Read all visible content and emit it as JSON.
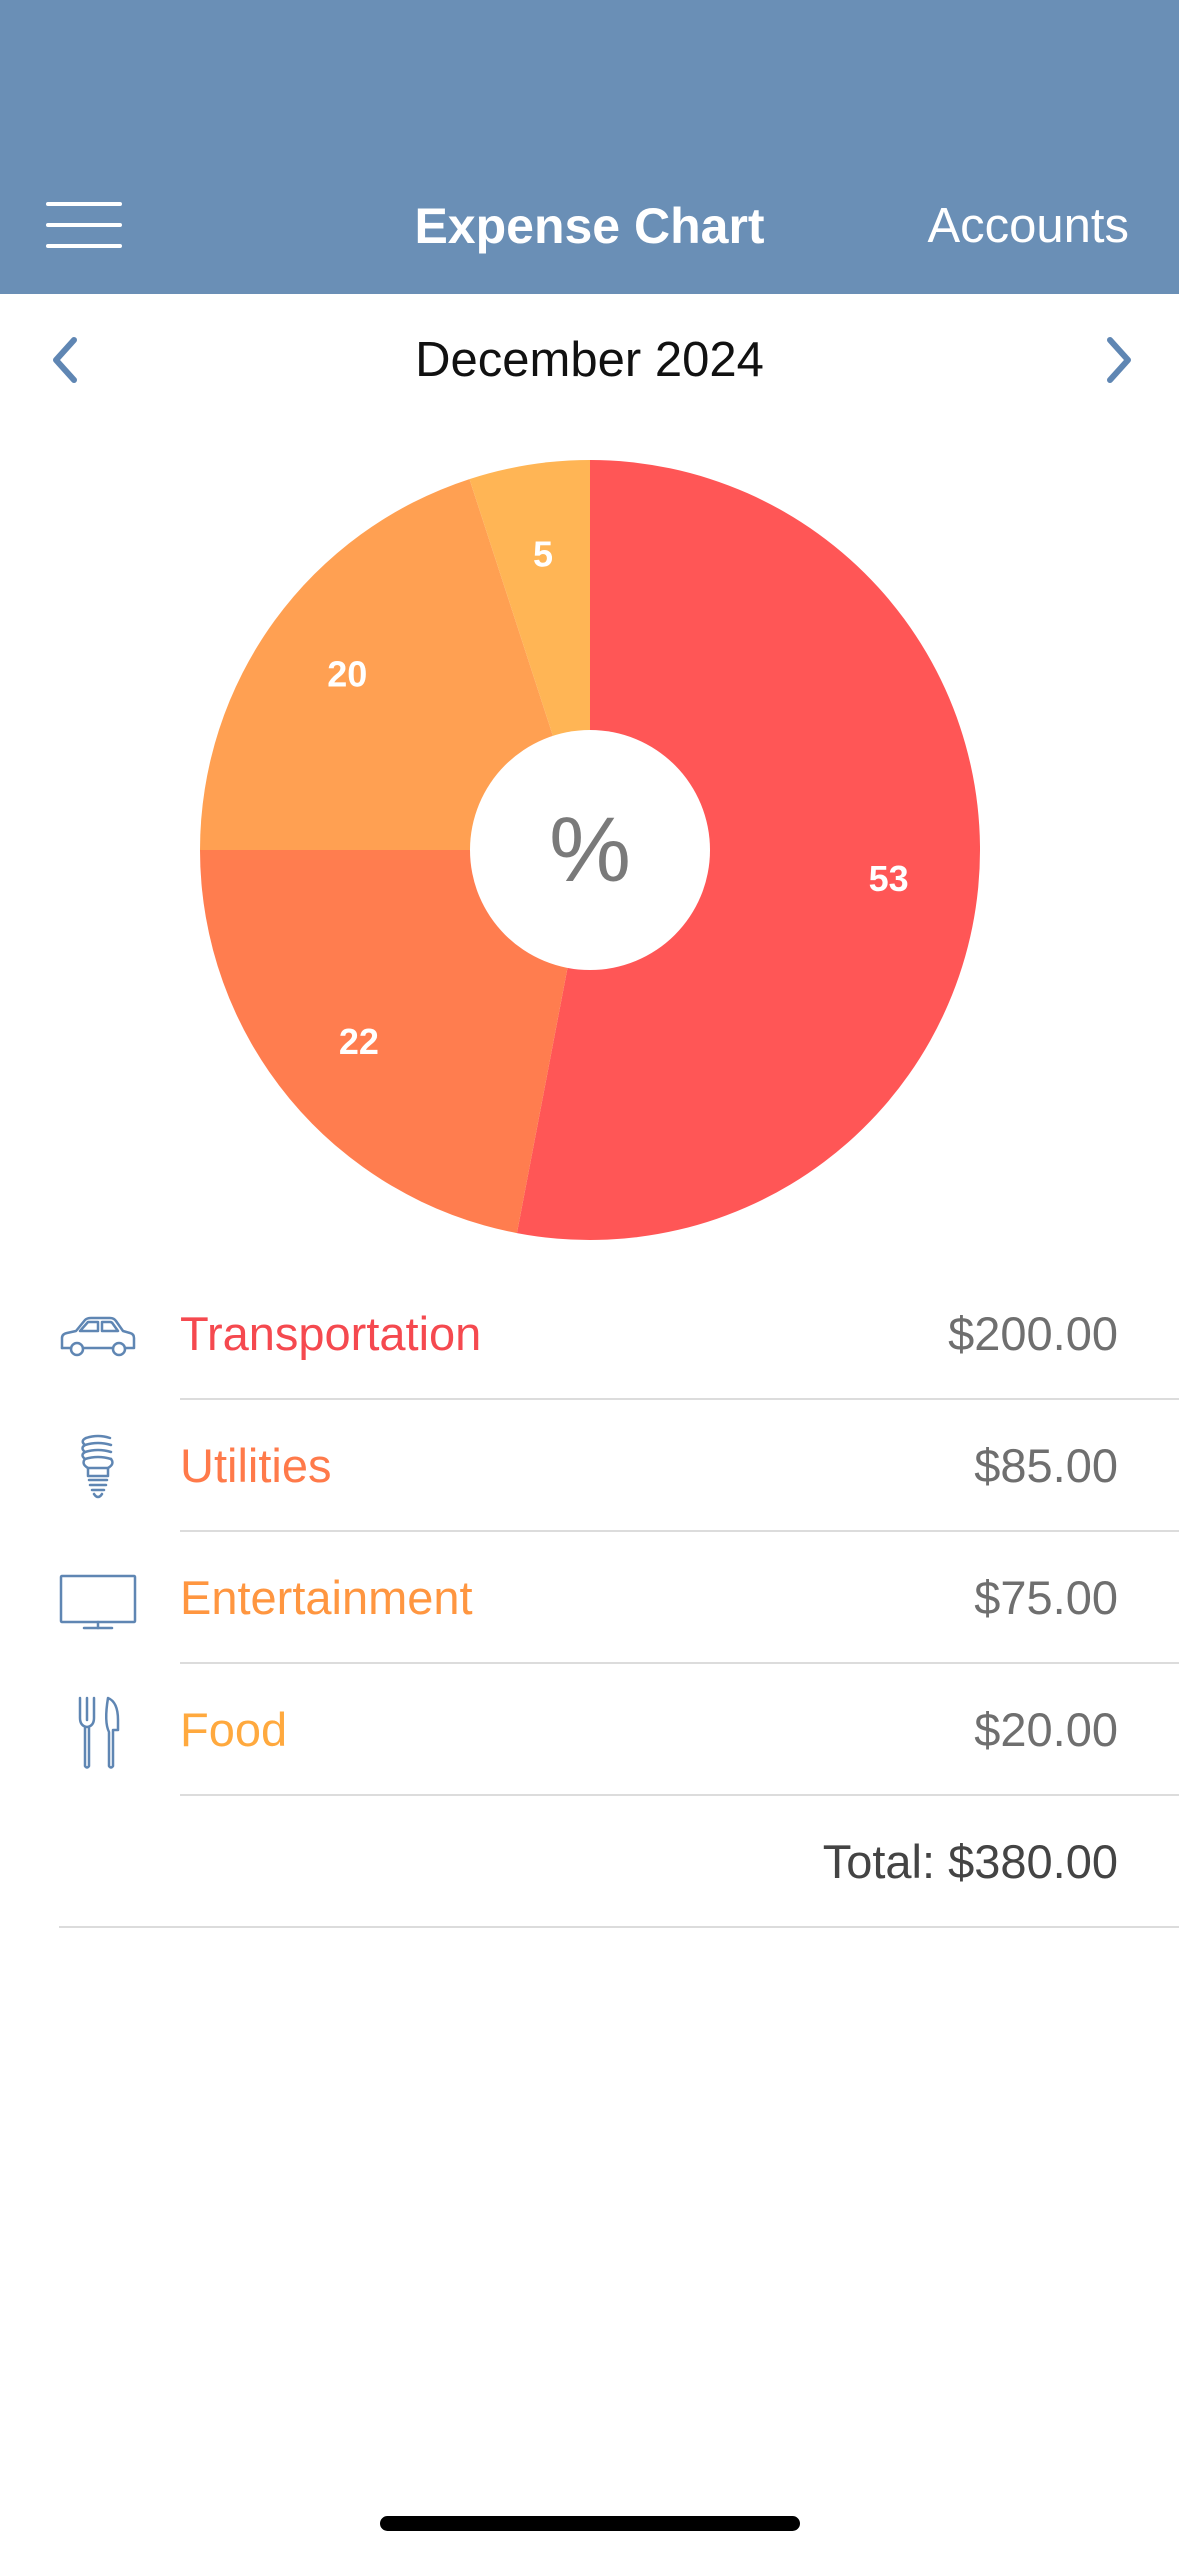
{
  "navbar": {
    "title": "Expense Chart",
    "right_label": "Accounts"
  },
  "period": {
    "label": "December 2024"
  },
  "chart_data": {
    "type": "pie",
    "title": "",
    "center_label": "%",
    "slices": [
      {
        "label": "53",
        "value": 53,
        "color": "#ff5656"
      },
      {
        "label": "22",
        "value": 22,
        "color": "#ff7d4f"
      },
      {
        "label": "20",
        "value": 20,
        "color": "#ffa052"
      },
      {
        "label": "5",
        "value": 5,
        "color": "#ffb555"
      }
    ]
  },
  "categories": [
    {
      "name": "Transportation",
      "amount": "$200.00",
      "color": "#f5494f",
      "icon": "car-icon"
    },
    {
      "name": "Utilities",
      "amount": "$85.00",
      "color": "#ff7a4a",
      "icon": "lightbulb-icon"
    },
    {
      "name": "Entertainment",
      "amount": "$75.00",
      "color": "#ff9640",
      "icon": "tv-icon"
    },
    {
      "name": "Food",
      "amount": "$20.00",
      "color": "#ffa93e",
      "icon": "fork-knife-icon"
    }
  ],
  "total": {
    "label": "Total: $380.00"
  },
  "colors": {
    "navbar": "#6a8fb6",
    "icon": "#5f86b3"
  }
}
